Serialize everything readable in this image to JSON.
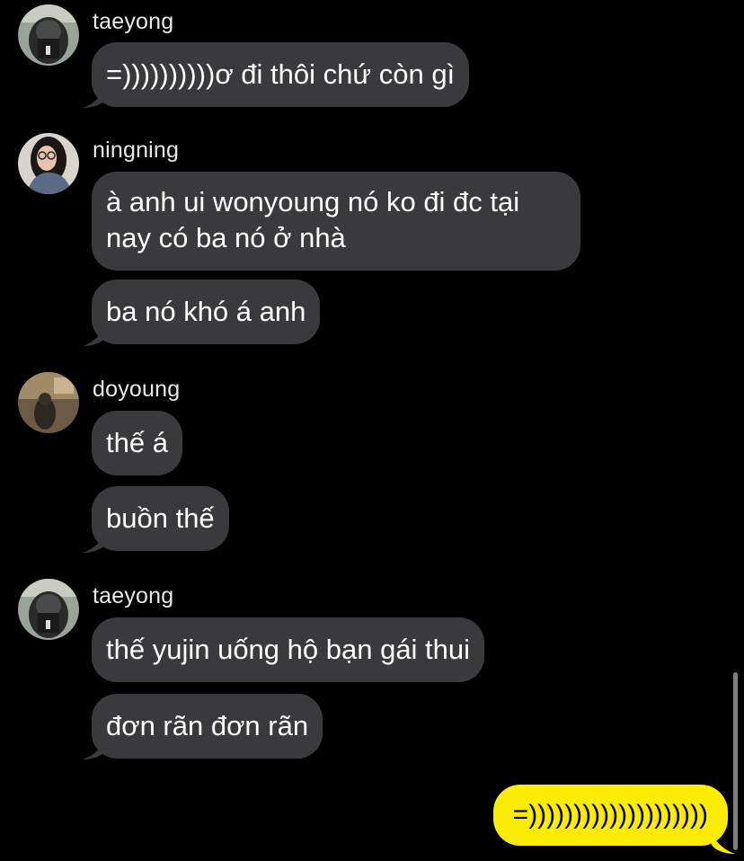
{
  "colors": {
    "background": "#000000",
    "incoming_bubble": "#3a3a3c",
    "outgoing_bubble": "#fcec03",
    "sender_name": "#e9e9ea"
  },
  "groups": [
    {
      "sender": "taeyong",
      "avatar_icon": "taeyong-avatar",
      "messages": [
        "=))))))))))ơ đi thôi chứ còn gì"
      ]
    },
    {
      "sender": "ningning",
      "avatar_icon": "ningning-avatar",
      "messages": [
        "à anh ui wonyoung nó ko đi đc tại nay có ba nó ở nhà",
        "ba nó khó á anh"
      ]
    },
    {
      "sender": "doyoung",
      "avatar_icon": "doyoung-avatar",
      "messages": [
        "thế á",
        "buồn thế"
      ]
    },
    {
      "sender": "taeyong",
      "avatar_icon": "taeyong-avatar",
      "messages": [
        "thế yujin uống hộ bạn gái thui",
        "đơn rãn đơn rãn"
      ]
    }
  ],
  "outgoing": {
    "text": "=))))))))))))))))))))"
  }
}
